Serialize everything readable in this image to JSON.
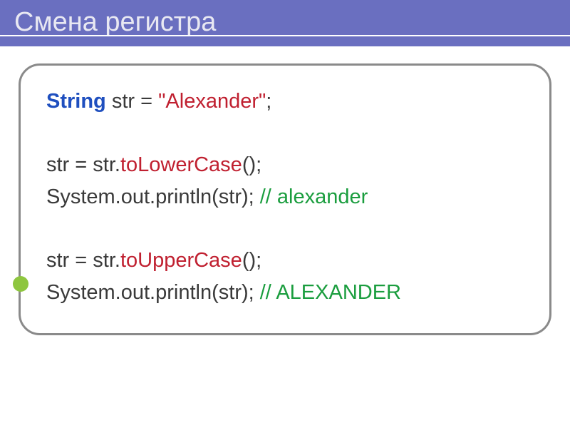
{
  "header": {
    "title": "Смена регистра"
  },
  "code": {
    "line1": {
      "type": "String",
      "var": " str = ",
      "literal": "\"Alexander\"",
      "end": ";"
    },
    "line2": {
      "left": "str = str.",
      "method": "toLowerCase",
      "end": "();"
    },
    "line3": {
      "call": "System.out.println(str); ",
      "comment": "// alexander"
    },
    "line4": {
      "left": "str = str.",
      "method": "toUpperCase",
      "end": "();"
    },
    "line5": {
      "call": "System.out.println(str); ",
      "comment": "// ALEXANDER"
    }
  }
}
